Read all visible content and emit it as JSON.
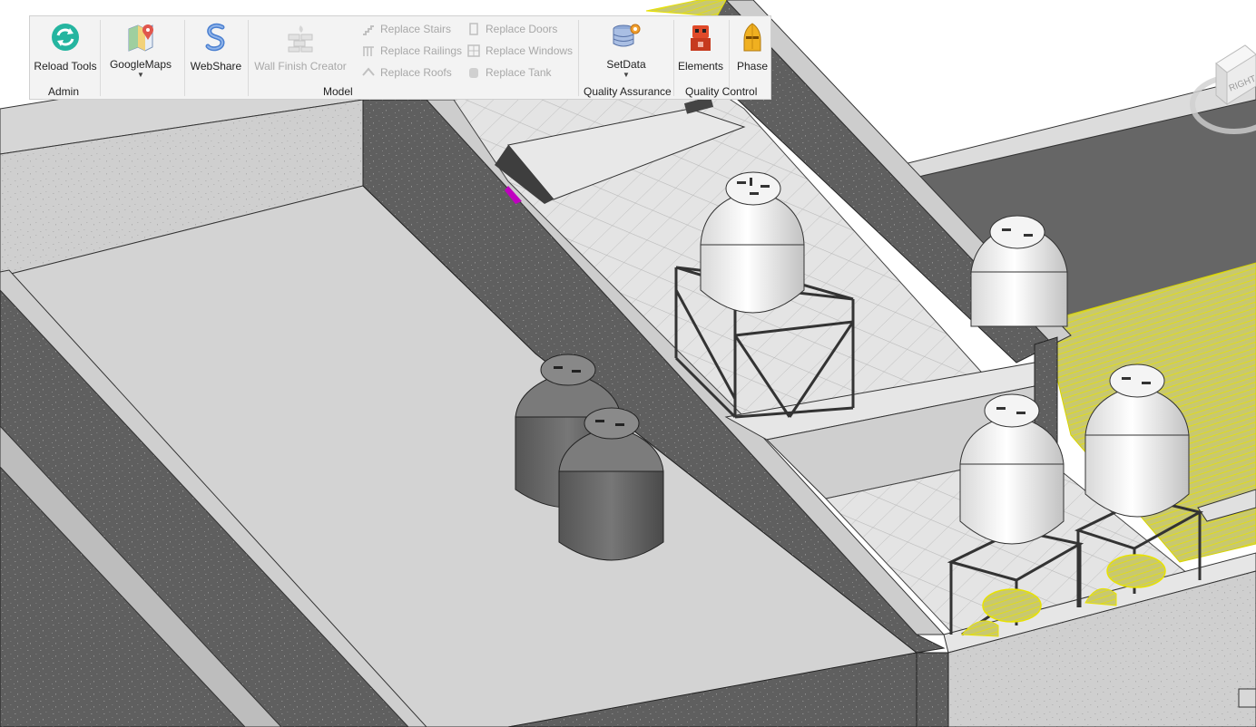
{
  "ribbon": {
    "buttons": {
      "reload_tools": "Reload Tools",
      "google_maps": "GoogleMaps",
      "webshare": "WebShare",
      "wall_finish_creator": "Wall Finish Creator",
      "setdata": "SetData",
      "elements": "Elements",
      "phase": "Phase"
    },
    "small_buttons": {
      "replace_stairs": "Replace Stairs",
      "replace_railings": "Replace Railings",
      "replace_roofs": "Replace Roofs",
      "replace_doors": "Replace Doors",
      "replace_windows": "Replace Windows",
      "replace_tank": "Replace Tank"
    },
    "groups": {
      "admin": "Admin",
      "model": "Model",
      "quality_assurance": "Quality Assurance",
      "quality_control": "Quality Control"
    }
  },
  "viewcube": {
    "face_label": "RIGHT"
  },
  "colors": {
    "ribbon_bg": "#f3f3f3",
    "wall_dark": "#5a5a5a",
    "wall_top": "#c9c9c9",
    "floor": "#d4d4d4",
    "tile_floor": "#e2e2e2",
    "tank_white": "#f0f0f0",
    "tank_dark": "#6a6a6a",
    "highlight_yellow": "#e8e200",
    "hatch_yellow": "#bfc24a"
  }
}
